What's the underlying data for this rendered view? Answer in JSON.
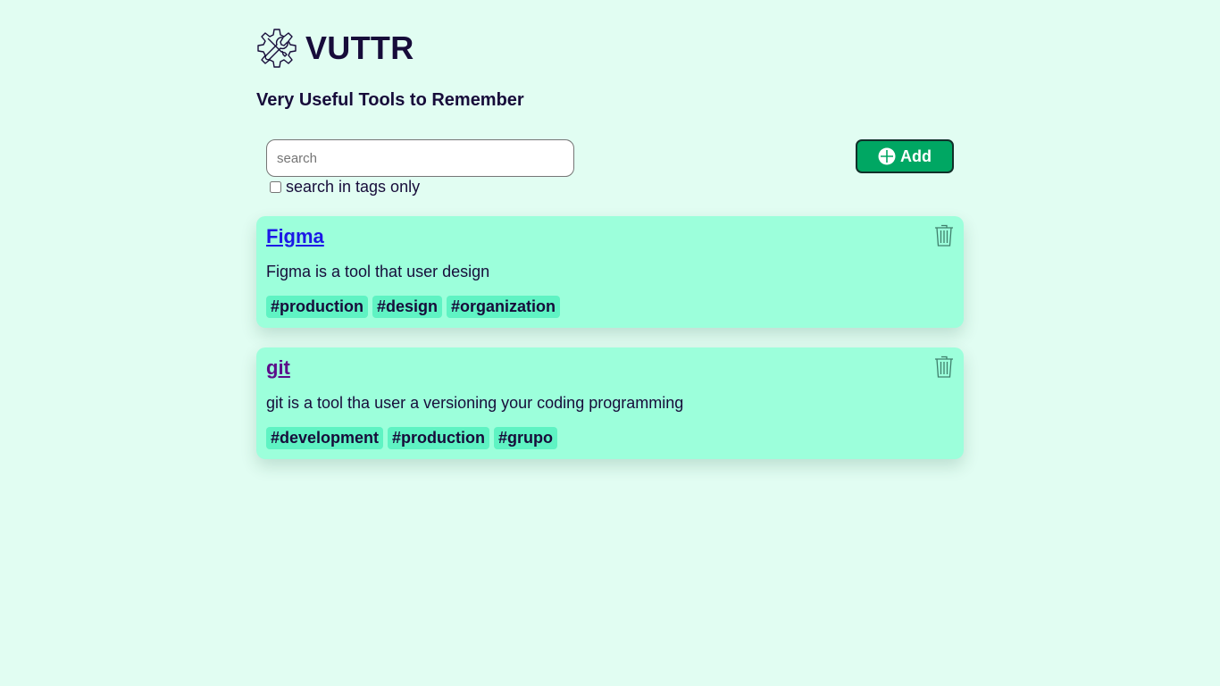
{
  "app": {
    "title": "VUTTR",
    "subtitle": "Very Useful Tools to Remember",
    "logo_icon": "gear-wrench-icon"
  },
  "search": {
    "placeholder": "search",
    "value": "",
    "tags_only_label": "search in tags only",
    "tags_only_checked": false
  },
  "add_button": {
    "label": "Add",
    "icon": "plus-circle-icon"
  },
  "colors": {
    "background": "#e1fdf2",
    "card": "#9cffdb",
    "tag": "#5ff3c3",
    "accent": "#00a763",
    "text": "#170c3a",
    "link_unvisited": "#1d18e6",
    "link_visited": "#5c0c8a"
  },
  "tools": [
    {
      "title": "Figma",
      "description": "Figma is a tool that user design",
      "tags": [
        "#production",
        "#design",
        "#organization"
      ],
      "delete_icon": "trash-icon"
    },
    {
      "title": "git",
      "description": "git is a tool tha user a versioning your coding programming",
      "tags": [
        "#development",
        "#production",
        "#grupo"
      ],
      "delete_icon": "trash-icon"
    }
  ]
}
